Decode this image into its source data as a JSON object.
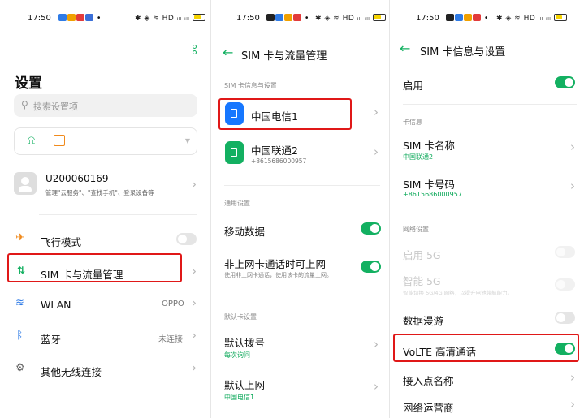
{
  "screen1": {
    "status": {
      "time": "17:50",
      "icons": "✱ ◈ ≋ HD ᵢₗₗ ᵢₗₗ"
    },
    "title": "设置",
    "search_placeholder": "搜索设置项",
    "account": {
      "name": "U200060169",
      "desc": "管理\"云服务\"、\"查找手机\"、登录设备等"
    },
    "items": [
      {
        "label": "飞行模式"
      },
      {
        "label": "SIM 卡与流量管理"
      },
      {
        "label": "WLAN",
        "value": "OPPO"
      },
      {
        "label": "蓝牙",
        "value": "未连接"
      },
      {
        "label": "其他无线连接"
      }
    ]
  },
  "screen2": {
    "status": {
      "time": "17:50",
      "icons": "✱ ◈ ≋ HD ᵢₗₗ ᵢₗₗ"
    },
    "header": "SIM 卡与流量管理",
    "section_sim": "SIM 卡信息与设置",
    "sim1": {
      "name": "中国电信1"
    },
    "sim2": {
      "name": "中国联通2",
      "number": "+8615686000957"
    },
    "section_general": "通用设置",
    "mobile_data": "移动数据",
    "nondefault": {
      "label": "非上网卡通话时可上网",
      "desc": "使用非上网卡通话，使用该卡的流量上网。"
    },
    "section_default": "默认卡设置",
    "default_call": {
      "label": "默认拨号",
      "value": "每次询问"
    },
    "default_data": {
      "label": "默认上网",
      "value": "中国电信1"
    }
  },
  "screen3": {
    "status": {
      "time": "17:50",
      "icons": "✱ ◈ ≋ HD ᵢₗₗ ᵢₗₗ"
    },
    "header": "SIM 卡信息与设置",
    "enable": "启用",
    "section_card": "卡信息",
    "sim_name": {
      "label": "SIM 卡名称",
      "value": "中国联通2"
    },
    "sim_number": {
      "label": "SIM 卡号码",
      "value": "+8615686000957"
    },
    "section_network": "网络设置",
    "enable5g": "启用 5G",
    "smart5g": {
      "label": "智能 5G",
      "desc": "智能切换 5G/4G 网络，以提升电池续航能力。"
    },
    "roaming": "数据漫游",
    "volte": "VoLTE 高清通话",
    "apn": "接入点名称",
    "operator": "网络运营商"
  },
  "colors": {
    "accent": "#13b061",
    "highlight": "#e01818",
    "sim_blue": "#1677ff"
  }
}
